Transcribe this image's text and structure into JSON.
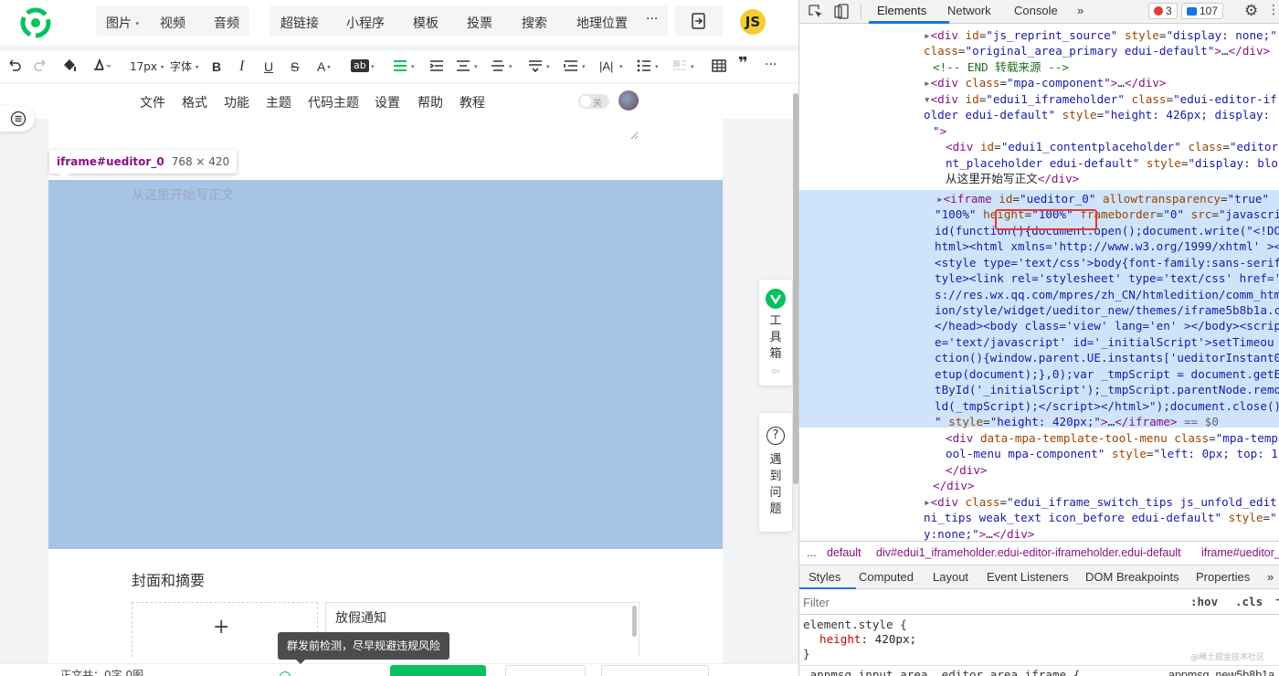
{
  "insert_bar": {
    "group1": [
      "图片",
      "视频",
      "音频"
    ],
    "group2": [
      "超链接",
      "小程序",
      "模板",
      "投票",
      "搜索",
      "地理位置"
    ],
    "more": "···",
    "avatar_text": "JS"
  },
  "format_toolbar": {
    "font_size": "17px",
    "font_family": "字体",
    "bold": "B",
    "italic": "I",
    "underline": "U",
    "strike": "S",
    "font_color": "A",
    "bg_color": "ab",
    "letter_spacing": "|A|"
  },
  "menu_bar": {
    "items": [
      "文件",
      "格式",
      "功能",
      "主题",
      "代码主题",
      "设置",
      "帮助",
      "教程"
    ],
    "toggle_label": "关"
  },
  "editor": {
    "placeholder": "从这里开始写正文",
    "inspect_tooltip": {
      "selector": "iframe#ueditor_0",
      "size": "768 × 420"
    },
    "cover_title": "封面和摘要",
    "digest_value": "放假通知",
    "word_count": "正文共：0字 0图",
    "risk_tip": "群发前检测，尽早规避违规风险"
  },
  "side_tools": {
    "toolbox": [
      "工",
      "具",
      "箱"
    ],
    "help": [
      "遇",
      "到",
      "问",
      "题"
    ]
  },
  "devtools": {
    "tabs": [
      "Elements",
      "Network",
      "Console",
      "»"
    ],
    "error_count": "3",
    "message_count": "107",
    "breadcrumb": [
      "...",
      "default",
      "div#edui1_iframeholder.edui-editor-iframeholder.edui-default",
      "iframe#ueditor_"
    ],
    "style_tabs": [
      "Styles",
      "Computed",
      "Layout",
      "Event Listeners",
      "DOM Breakpoints",
      "Properties",
      "»"
    ],
    "filter_placeholder": "Filter",
    "filter_hov": ":hov",
    "filter_cls": ".cls",
    "filter_plus": "+",
    "element_style_selector": "element.style {",
    "element_style_prop": "height",
    "element_style_value": "420px;",
    "close_brace": "}",
    "next_rule": ".appmsg_input_area .editor_area iframe {",
    "next_rule_source": "appmsg_new5b8b1a",
    "watermark": "@稀土掘金技术社区"
  },
  "colors": {
    "highlight": "#a6c4e6",
    "accent_green": "#07c160",
    "devtools_selected": "#cfe3fb",
    "red_box": "#e53935"
  }
}
